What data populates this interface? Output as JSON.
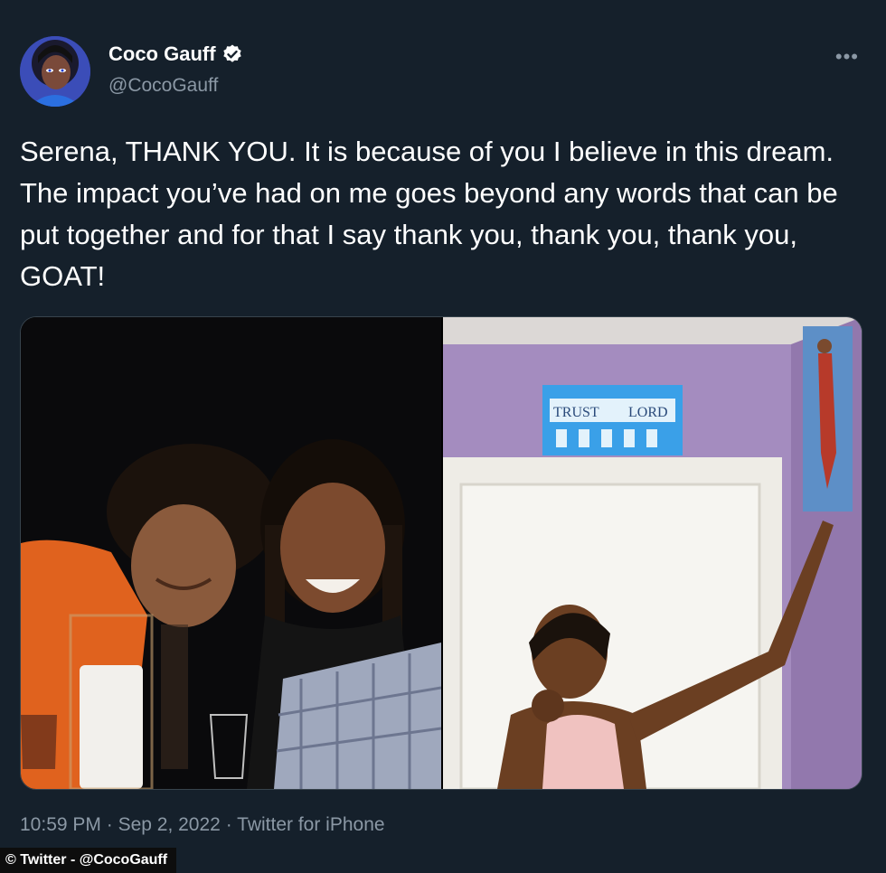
{
  "tweet": {
    "display_name": "Coco Gauff",
    "handle": "@CocoGauff",
    "verified": true,
    "verified_icon": "verified-badge-icon",
    "more_icon": "more-options-icon",
    "text": "Serena, THANK YOU. It is because of you I believe in this dream. The impact you’ve had on me goes beyond any words that can be put together and for that I say thank you, thank you, thank you, GOAT!",
    "media": {
      "left_photo": "photo of two women smiling at a dinner table",
      "right_photo": "photo of girl pointing at a poster on a purple wall",
      "sign_text": "TRUST LORD"
    },
    "time": "10:59 PM",
    "separator": "·",
    "date": "Sep 2, 2022",
    "source": "Twitter for iPhone"
  },
  "credit": "© Twitter - @CocoGauff",
  "colors": {
    "background": "#15202b",
    "secondary_text": "#8b98a5",
    "border": "#38444d"
  }
}
